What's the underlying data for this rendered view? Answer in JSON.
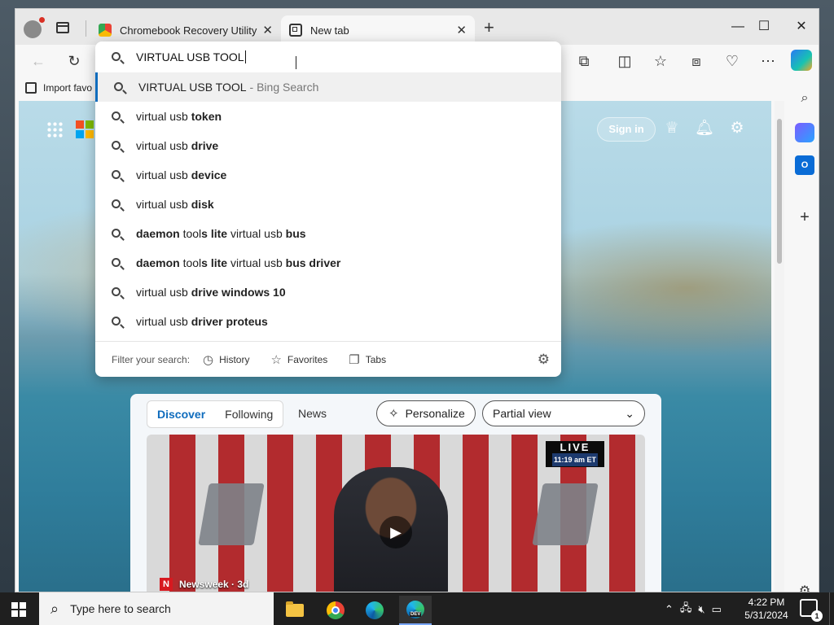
{
  "browser": {
    "tabs": [
      {
        "title": "Chromebook Recovery Utility",
        "active": false
      },
      {
        "title": "New tab",
        "active": true
      }
    ],
    "window_controls": {
      "minimize": "—",
      "maximize": "☐",
      "close": "✕"
    },
    "favorites_bar": {
      "import_label": "Import favo"
    }
  },
  "omnibox": {
    "typed_text": "VIRTUAL USB TOOL",
    "top_suggestion": {
      "text": "VIRTUAL USB TOOL",
      "hint": "- Bing Search"
    },
    "suggestions": [
      {
        "prefix": "virtual usb ",
        "bold": "token"
      },
      {
        "prefix": "virtual usb ",
        "bold": "drive"
      },
      {
        "prefix": "virtual usb ",
        "bold": "device"
      },
      {
        "prefix": "virtual usb ",
        "bold": "disk"
      },
      {
        "bold1": "daemon",
        "mid1": " tool",
        "bold2": "s lite",
        "mid2": " virtual usb ",
        "bold3": "bus"
      },
      {
        "bold1": "daemon",
        "mid1": " tool",
        "bold2": "s lite",
        "mid2": " virtual usb ",
        "bold3": "bus driver"
      },
      {
        "prefix": "virtual usb ",
        "bold": "drive windows 10"
      },
      {
        "prefix": "virtual usb ",
        "bold": "driver proteus"
      }
    ],
    "filter": {
      "label": "Filter your search:",
      "history": "History",
      "favorites": "Favorites",
      "tabs": "Tabs"
    }
  },
  "newtab": {
    "signin_label": "Sign in",
    "feed": {
      "tabs": [
        "Discover",
        "Following"
      ],
      "news_label": "News",
      "personalize_label": "Personalize",
      "view_select": "Partial view",
      "video": {
        "live_label": "LIVE",
        "live_time": "11:19 am ET",
        "source": "Newsweek · 3d",
        "source_logo": "N"
      }
    }
  },
  "taskbar": {
    "search_placeholder": "Type here to search",
    "time": "4:22 PM",
    "date": "5/31/2024",
    "notification_count": "1"
  },
  "colors": {
    "accent": "#0f6cbd",
    "ms_logo": [
      "#f25022",
      "#7fba00",
      "#00a4ef",
      "#ffb900"
    ]
  }
}
